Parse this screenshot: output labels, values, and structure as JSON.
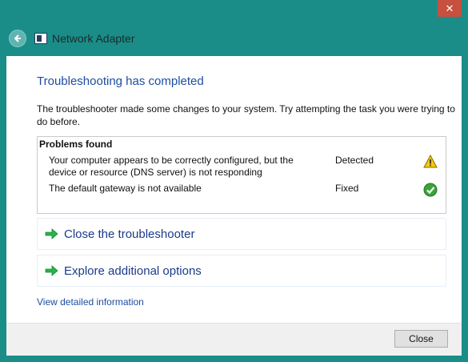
{
  "window": {
    "title": "Network Adapter",
    "close_glyph": "✕"
  },
  "main": {
    "heading": "Troubleshooting has completed",
    "description": "The troubleshooter made some changes to your system. Try attempting the task you were trying to do before.",
    "problems": {
      "title": "Problems found",
      "items": [
        {
          "text": "Your computer appears to be correctly configured, but the device or resource (DNS server) is not responding",
          "status": "Detected",
          "icon": "warning-icon"
        },
        {
          "text": "The default gateway is not available",
          "status": "Fixed",
          "icon": "checkmark-icon"
        }
      ]
    },
    "commands": [
      {
        "label": "Close the troubleshooter",
        "icon": "green-arrow-icon"
      },
      {
        "label": "Explore additional options",
        "icon": "green-arrow-icon"
      }
    ],
    "details_link": "View detailed information"
  },
  "footer": {
    "close_label": "Close"
  },
  "colors": {
    "frame": "#1a8d89",
    "heading": "#1d4da0",
    "command_text": "#1a3a8c",
    "warning": "#f2c811",
    "ok": "#3aa43a"
  }
}
